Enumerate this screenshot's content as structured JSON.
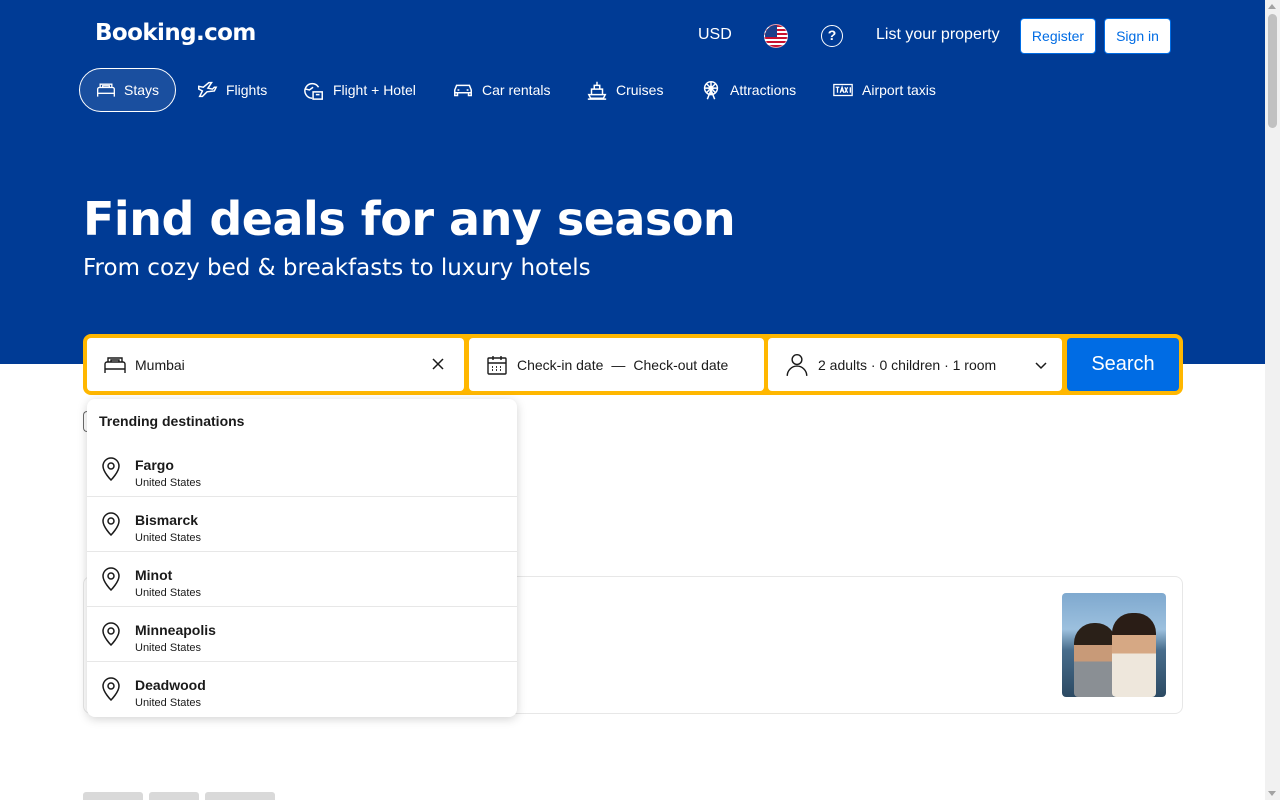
{
  "header": {
    "logo": "Booking.com",
    "currency": "USD",
    "language_flag_icon": "us-flag-icon",
    "help_icon": "question-circle-icon",
    "help_glyph": "?",
    "list_property": "List your property",
    "register": "Register",
    "sign_in": "Sign in"
  },
  "nav": {
    "items": [
      {
        "label": "Stays",
        "icon": "bed-icon",
        "active": true
      },
      {
        "label": "Flights",
        "icon": "plane-icon",
        "active": false
      },
      {
        "label": "Flight + Hotel",
        "icon": "flight-hotel-icon",
        "active": false
      },
      {
        "label": "Car rentals",
        "icon": "car-icon",
        "active": false
      },
      {
        "label": "Cruises",
        "icon": "ship-icon",
        "active": false
      },
      {
        "label": "Attractions",
        "icon": "ferris-wheel-icon",
        "active": false
      },
      {
        "label": "Airport taxis",
        "icon": "taxi-icon",
        "active": false
      }
    ]
  },
  "hero": {
    "title": "Find deals for any season",
    "subtitle": "From cozy bed & breakfasts to luxury hotels"
  },
  "search": {
    "destination_value": "Mumbai",
    "checkin_placeholder": "Check-in date",
    "date_separator": "—",
    "checkout_placeholder": "Check-out date",
    "guests": "2 adults · 0 children · 1 room",
    "button": "Search"
  },
  "dropdown": {
    "title": "Trending destinations",
    "items": [
      {
        "name": "Fargo",
        "country": "United States"
      },
      {
        "name": "Bismarck",
        "country": "United States"
      },
      {
        "name": "Minot",
        "country": "United States"
      },
      {
        "name": "Minneapolis",
        "country": "United States"
      },
      {
        "name": "Deadwood",
        "country": "United States"
      }
    ]
  },
  "colors": {
    "brand_blue": "#003b95",
    "action_blue": "#006ce4",
    "search_border_yellow": "#ffb700"
  }
}
